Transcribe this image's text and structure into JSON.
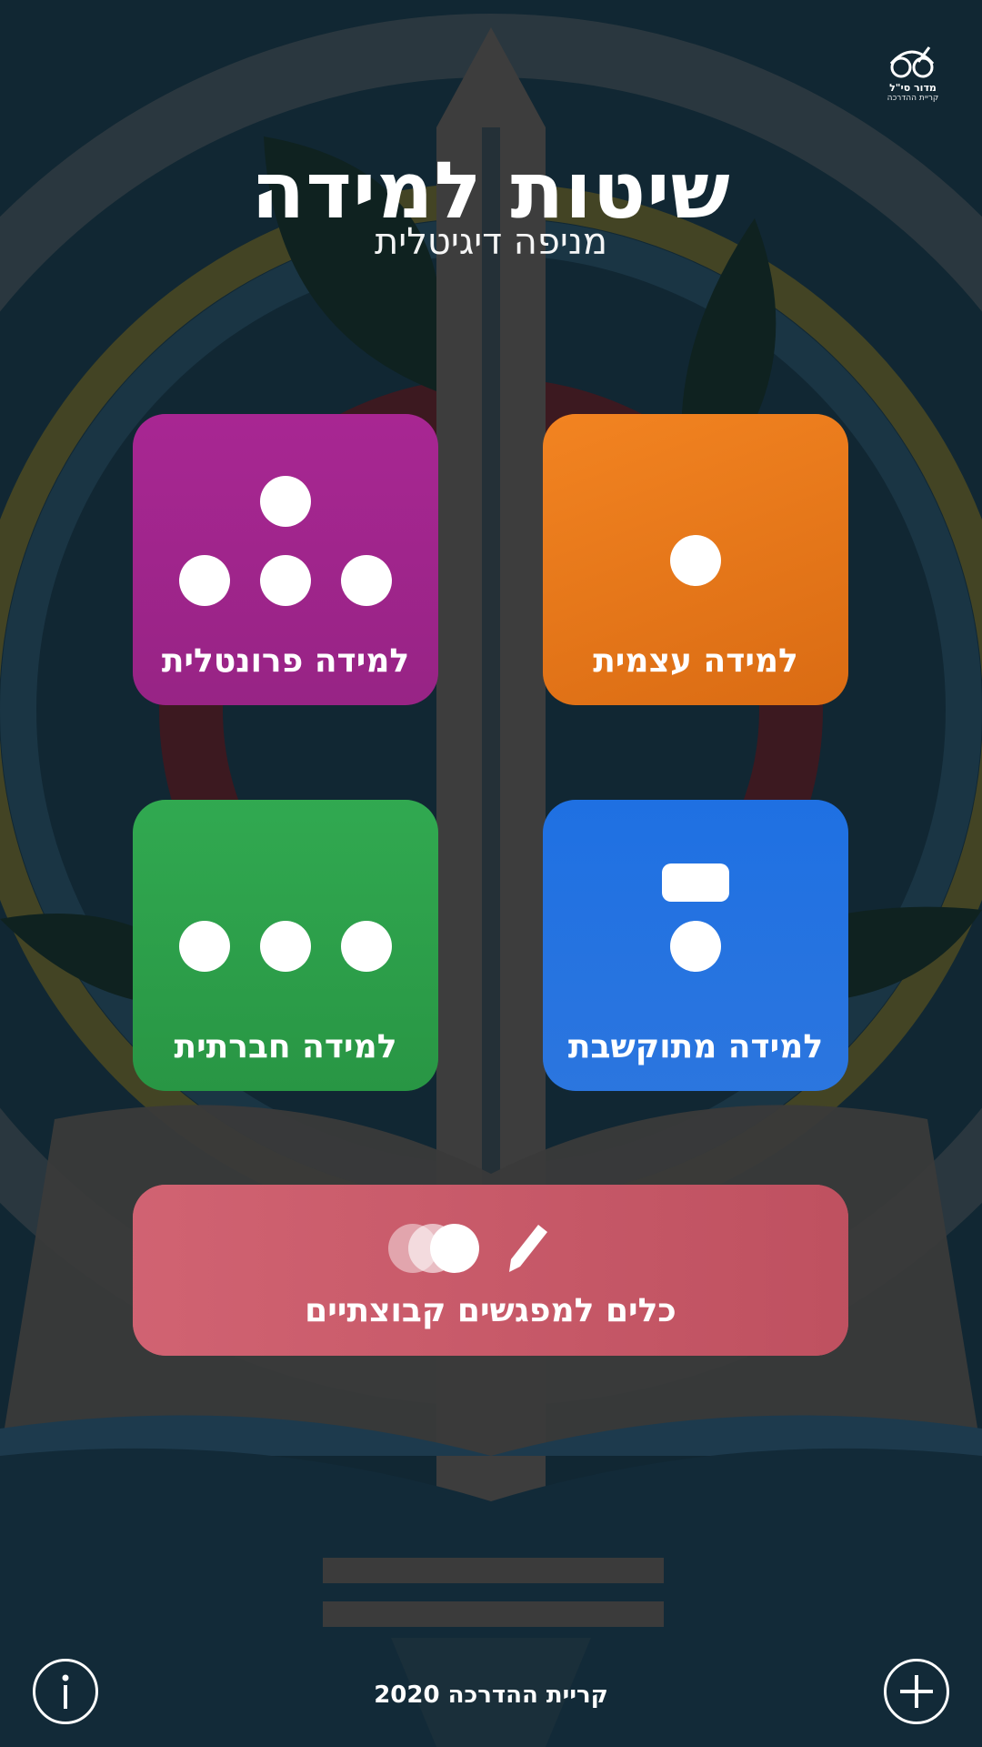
{
  "header": {
    "title": "שיטות למידה",
    "subtitle": "מניפה דיגיטלית",
    "logo": {
      "name": "מדור סי\"ל",
      "sub": "קריית ההדרכה",
      "icon": "glasses-pencil-logo"
    }
  },
  "tiles": [
    {
      "id": "frontal",
      "label": "למידה פרונטלית",
      "color": "#a5268f",
      "icon": "dots-triangle-icon"
    },
    {
      "id": "self",
      "label": "למידה עצמית",
      "color": "#ee7a18",
      "icon": "single-dot-icon"
    },
    {
      "id": "social",
      "label": "למידה חברתית",
      "color": "#2ea64e",
      "icon": "dots-row-icon"
    },
    {
      "id": "computer",
      "label": "למידה מתוקשבת",
      "color": "#1d6fe0",
      "icon": "screen-dot-icon"
    }
  ],
  "tools": {
    "label": "כלים למפגשים קבוצתיים",
    "color": "#c45667",
    "icons": [
      "overlapping-circles-icon",
      "pencil-icon"
    ]
  },
  "footer": {
    "text": "קריית ההדרכה 2020"
  },
  "buttons": {
    "info": "info-icon",
    "add": "plus-icon"
  }
}
